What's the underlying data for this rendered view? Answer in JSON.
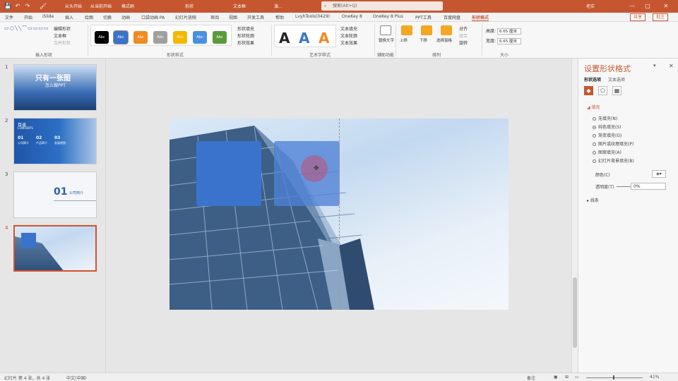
{
  "titlebar": {
    "quick_access": [
      "💾",
      "↶",
      "↷",
      "🖌"
    ],
    "labels": [
      "从头开始",
      "从当前开始",
      "格式刷",
      "形状",
      "文本框"
    ],
    "doc_title": "演...",
    "search_placeholder": "搜索(Alt+Q)",
    "user": "老实",
    "window_icons": [
      "—",
      "□",
      "✕"
    ]
  },
  "tabs": {
    "items": [
      "文件",
      "开始",
      "iSlide",
      "插入",
      "绘图",
      "切换",
      "动画",
      "口袋动画 PA",
      "幻灯片放映",
      "审阅",
      "视图",
      "开发工具",
      "帮助",
      "LvyhTools(0429)",
      "OneKey 8",
      "OneKey 8 Plus",
      "PPT工具",
      "百度网盘",
      "形状格式"
    ],
    "active_index": 18,
    "share": "共享",
    "comment": "批注"
  },
  "ribbon": {
    "groups": {
      "insert_shapes": "插入形状",
      "shape_styles": "形状样式",
      "wordart_styles": "艺术字样式",
      "accessibility": "辅助功能",
      "arrange": "排列",
      "size": "大小"
    },
    "insert_items": [
      "编辑形状",
      "文本框",
      "合并形状"
    ],
    "style_boxes": [
      {
        "label": "Abc",
        "color": "#000000"
      },
      {
        "label": "Abc",
        "color": "#3a73cc"
      },
      {
        "label": "Abc",
        "color": "#f08a24"
      },
      {
        "label": "Abc",
        "color": "#a0a0a0"
      },
      {
        "label": "Abc",
        "color": "#f5b800"
      },
      {
        "label": "Abc",
        "color": "#4a90e2"
      },
      {
        "label": "Abc",
        "color": "#5a9b3c"
      }
    ],
    "fill_items": [
      "形状填充",
      "形状轮廓",
      "形状效果"
    ],
    "wordart_letters": [
      {
        "letter": "A",
        "color": "#222222"
      },
      {
        "letter": "A",
        "color": "#3a73cc"
      },
      {
        "letter": "A",
        "color": "#f08a24"
      }
    ],
    "text_items": [
      "文本填充",
      "文本轮廓",
      "文本效果"
    ],
    "alt_text": "替换文字",
    "arrange_buttons": [
      "上移",
      "下移",
      "选择窗格"
    ],
    "arrange_items": [
      "对齐",
      "组合",
      "旋转"
    ],
    "size": {
      "height_label": "高度:",
      "height": "6.65 厘米",
      "width_label": "宽度:",
      "width": "6.65 厘米"
    }
  },
  "slides": {
    "numbers": [
      "1",
      "2",
      "3",
      "4"
    ],
    "thumb1": {
      "title": "只有一张图",
      "subtitle": "怎么做PPT"
    },
    "thumb2": {
      "title": "目录",
      "subtitle": "CONTENTS",
      "items": [
        "01",
        "02",
        "03"
      ],
      "item_labels": [
        "公司简介",
        "产品简介",
        "发展规划"
      ]
    },
    "thumb3": {
      "number": "01",
      "label": "公司简介"
    },
    "selected_index": 3
  },
  "pane": {
    "title": "设置形状格式",
    "tabs": [
      "形状选项",
      "文本选项"
    ],
    "section_fill": "填充",
    "fill_options": [
      "无填充(N)",
      "纯色填充(S)",
      "渐变填充(G)",
      "图片或纹理填充(P)",
      "图案填充(A)",
      "幻灯片背景填充(B)"
    ],
    "selected_fill_index": 1,
    "color_label": "颜色(C)",
    "transparency_label": "透明度(T)",
    "transparency_value": "0%",
    "section_line": "线条"
  },
  "status": {
    "slide_info": "幻灯片 第 4 张，共 4 张",
    "language": "中文(中国)",
    "notes": "备注",
    "zoom": "41%"
  }
}
